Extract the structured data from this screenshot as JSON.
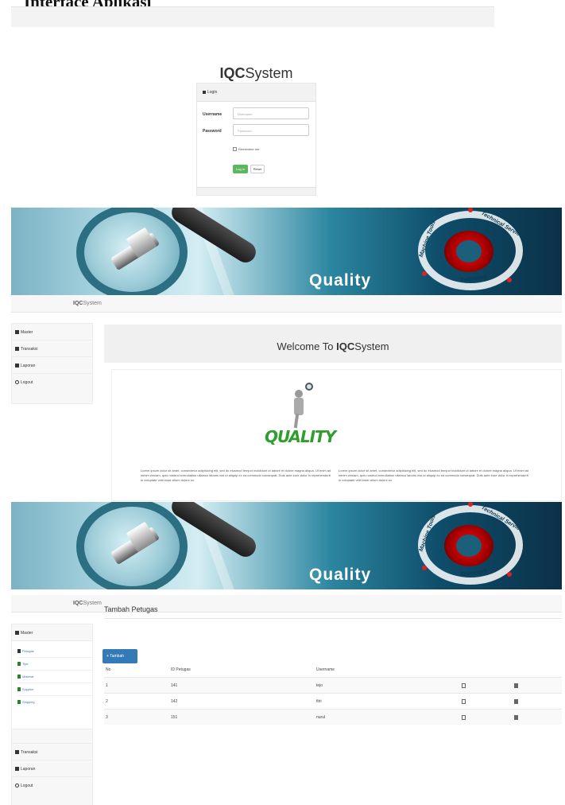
{
  "doc": {
    "heading": "Interface Aplikasi"
  },
  "login": {
    "title_bold": "IQC",
    "title_rest": "System",
    "panel_heading": "Login",
    "username_label": "Username",
    "username_placeholder": "Username",
    "password_label": "Password",
    "password_placeholder": "Password",
    "remember_label": "Remember me",
    "login_button": "Log in",
    "reset_button": "Reset"
  },
  "banner": {
    "word": "Quality",
    "ring_labels": [
      "Technical Service",
      "Teamwork",
      "Machine Tools"
    ]
  },
  "navbar": {
    "brand_bold": "IQC",
    "brand_rest": "System"
  },
  "sidebar_home": {
    "items": [
      {
        "label": "Master",
        "icon": "user-icon"
      },
      {
        "label": "Transaksi",
        "icon": "list-icon"
      },
      {
        "label": "Laporan",
        "icon": "person-icon"
      },
      {
        "label": "Logout",
        "icon": "power-icon"
      }
    ]
  },
  "welcome": {
    "prefix": "Welcome To ",
    "bold": "IQC",
    "suffix": "System",
    "logo_text": "QUALITY",
    "lorem_left": "Lorem ipsum dolor sit amet, consectetur adipisicing elit, sed do eiusmod tempor incididunt ut labore et dolore magna aliqua. Ut enim ad minim veniam, quis nostrud exercitation ullamco laboris nisi ut aliquip ex ea commodo consequat. Duis aute irure dolor in reprehenderit in voluptate velit esse cillum dolore eu",
    "lorem_right": "Lorem ipsum dolor sit amet, consectetur adipisicing elit, sed do eiusmod tempor incididunt ut labore et dolore magna aliqua. Ut enim ad minim veniam, quis nostrud exercitation ullamco laboris nisi ut aliquip ex ea commodo consequat. Duis aute irure dolor in reprehenderit in voluptate velit esse cillum dolore eu"
  },
  "sidebar_petugas": {
    "master_label": "Master",
    "sub_items": [
      "Petugas",
      "Tipe",
      "Material",
      "Supplier",
      "Shipping"
    ],
    "bottom_items": [
      "Transaksi",
      "Laporan",
      "Logout"
    ]
  },
  "petugas": {
    "title": "Tambah Petugas",
    "add_button": "+ Tambah",
    "columns": [
      "No",
      "ID Petugas",
      "Username"
    ],
    "rows": [
      [
        "1",
        "141",
        "tejo"
      ],
      [
        "2",
        "142",
        "fitri"
      ],
      [
        "3",
        "151",
        "nurul"
      ]
    ]
  }
}
